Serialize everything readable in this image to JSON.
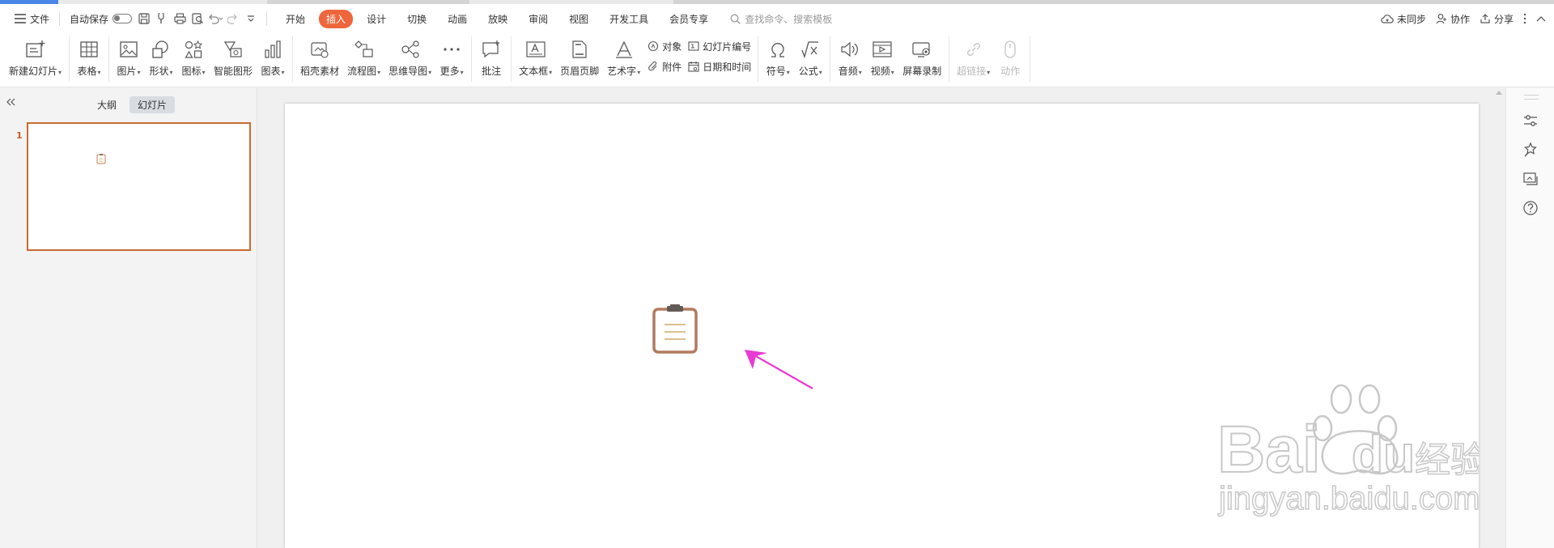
{
  "menubar": {
    "file_label": "文件",
    "autosave_label": "自动保存",
    "tabs": [
      {
        "label": "开始"
      },
      {
        "label": "插入",
        "active": true
      },
      {
        "label": "设计"
      },
      {
        "label": "切换"
      },
      {
        "label": "动画"
      },
      {
        "label": "放映"
      },
      {
        "label": "审阅"
      },
      {
        "label": "视图"
      },
      {
        "label": "开发工具"
      },
      {
        "label": "会员专享"
      }
    ],
    "search_placeholder": "查找命令、搜索模板",
    "right": {
      "sync_label": "未同步",
      "collab_label": "协作",
      "share_label": "分享"
    },
    "active_tab_color": "#f0663c"
  },
  "ribbon": {
    "new_slide": "新建幻灯片",
    "table": "表格",
    "picture": "图片",
    "shape": "形状",
    "icon": "图标",
    "smart_graphic": "智能图形",
    "chart": "图表",
    "docer_assets": "稻壳素材",
    "flowchart": "流程图",
    "mindmap": "思维导图",
    "more": "更多",
    "comment": "批注",
    "textbox": "文本框",
    "header_footer": "页眉页脚",
    "wordart": "艺术字",
    "object": "对象",
    "attachment": "附件",
    "slide_number": "幻灯片编号",
    "datetime": "日期和时间",
    "symbol": "符号",
    "formula": "公式",
    "audio": "音频",
    "video": "视频",
    "screen_record": "屏幕录制",
    "hyperlink": "超链接",
    "action": "动作"
  },
  "left_panel": {
    "outline_tab": "大纲",
    "slides_tab": "幻灯片",
    "slide_number": "1",
    "thumb_border_color": "#c96a2f"
  },
  "slide": {
    "icon": "clipboard-icon",
    "annotation_color": "#e93bd1"
  },
  "watermark": {
    "brand": "Bai",
    "brand_tail": "du",
    "brand_cn": "经验",
    "url": "jingyan.baidu.com"
  }
}
